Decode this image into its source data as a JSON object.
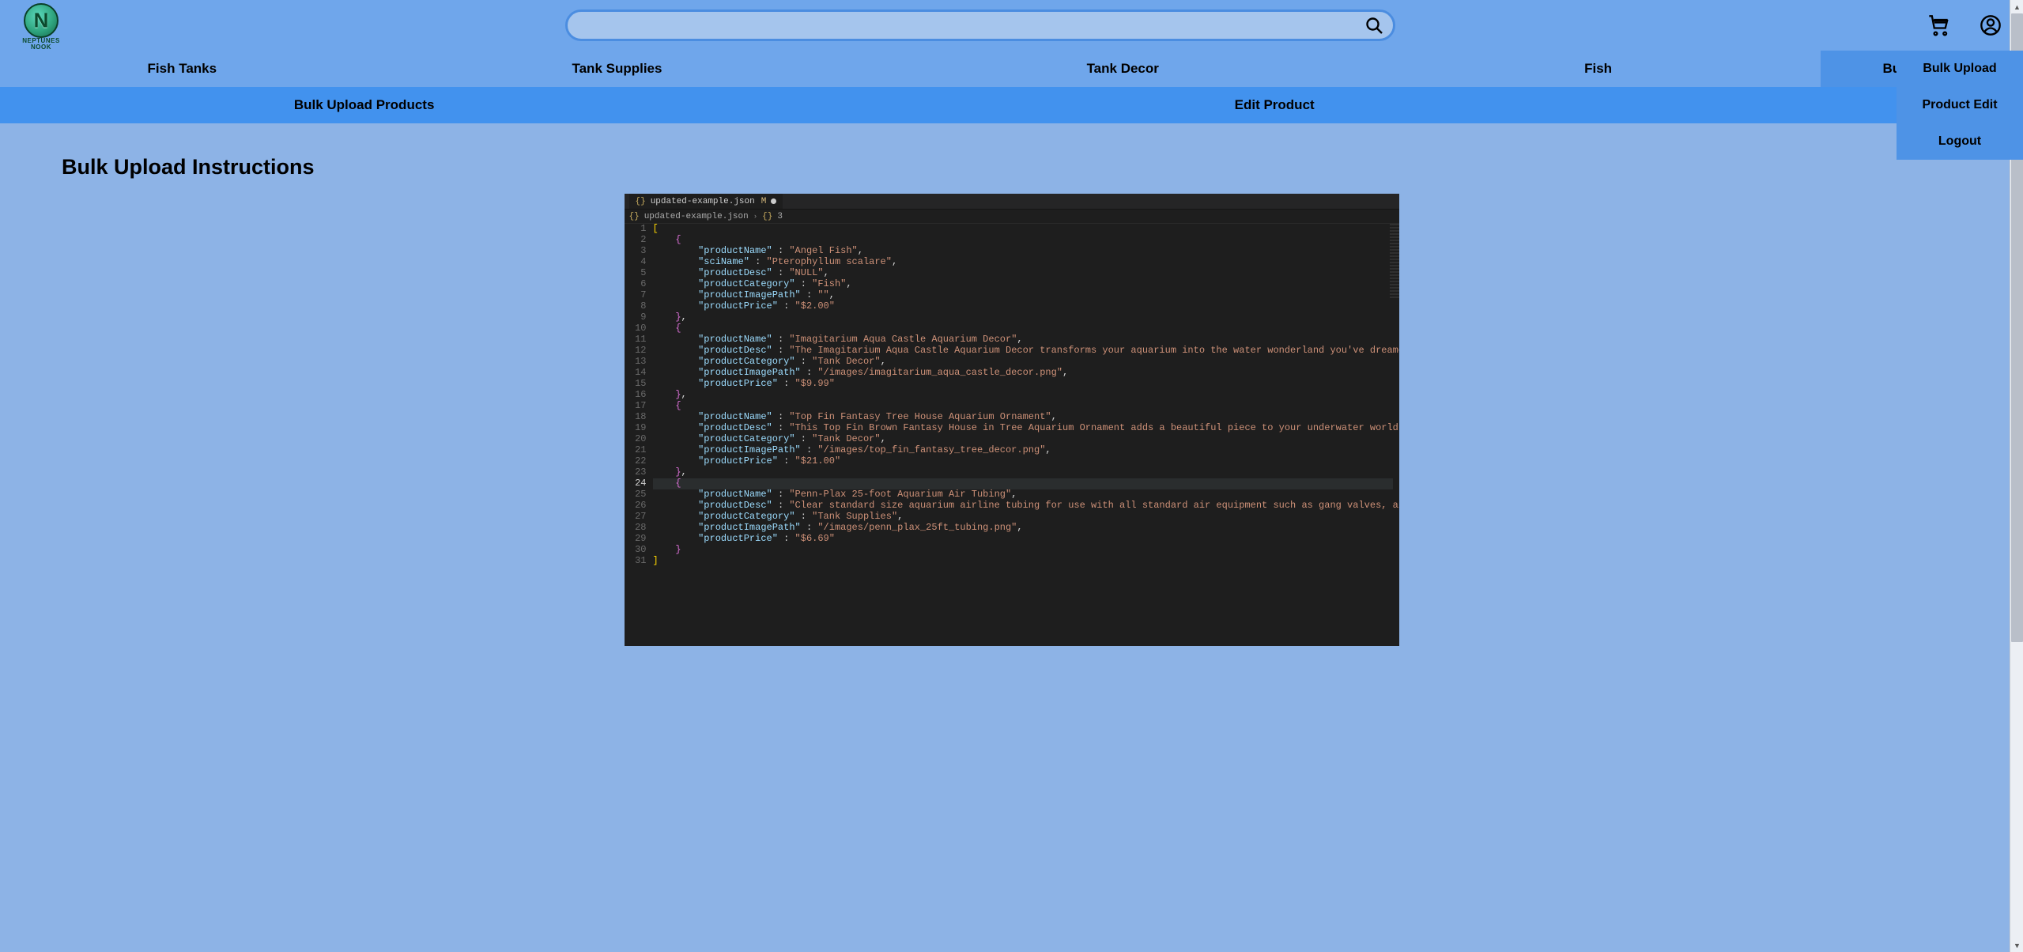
{
  "brand": {
    "top": "NEPTUNES",
    "bottom": "NOOK"
  },
  "search": {
    "placeholder": ""
  },
  "nav": {
    "primary": [
      "Fish Tanks",
      "Tank Supplies",
      "Tank Decor",
      "Fish",
      "Bulk Upload"
    ],
    "secondary": [
      "Bulk Upload Products",
      "Edit Product"
    ]
  },
  "dropdown": [
    "Bulk Upload",
    "Product Edit",
    "Logout"
  ],
  "page": {
    "title": "Bulk Upload Instructions"
  },
  "editor": {
    "filename": "updated-example.json",
    "modified_flag": "M",
    "breadcrumb_file": "updated-example.json",
    "breadcrumb_node": "3",
    "active_line": 24,
    "line_count": 31,
    "products": [
      {
        "productName": "Angel Fish",
        "sciName": "Pterophyllum scalare",
        "productDesc": "NULL",
        "productCategory": "Fish",
        "productImagePath": "",
        "productPrice": "$2.00"
      },
      {
        "productName": "Imagitarium Aqua Castle Aquarium Decor",
        "productDesc": "The Imagitarium Aqua Castle Aquarium Decor transforms your aquarium into the water wonderland you've dreamed of. With a splash of color and texture they'll love to swim a",
        "productCategory": "Tank Decor",
        "productImagePath": "/images/imagitarium_aqua_castle_decor.png",
        "productPrice": "$9.99"
      },
      {
        "productName": "Top Fin Fantasy Tree House Aquarium Ornament",
        "productDesc": "This Top Fin Brown Fantasy House in Tree Aquarium Ornament adds a beautiful piece to your underwater world. Crafted in a very realistic way, this piece features a house b",
        "productCategory": "Tank Decor",
        "productImagePath": "/images/top_fin_fantasy_tree_decor.png",
        "productPrice": "$21.00"
      },
      {
        "productName": "Penn-Plax 25-foot Aquarium Air Tubing",
        "productDesc": "Clear standard size aquarium airline tubing for use with all standard air equipment such as gang valves, air operated toys and air stones. 25ft length is ideal for larger",
        "productCategory": "Tank Supplies",
        "productImagePath": "/images/penn_plax_25ft_tubing.png",
        "productPrice": "$6.69"
      }
    ]
  }
}
